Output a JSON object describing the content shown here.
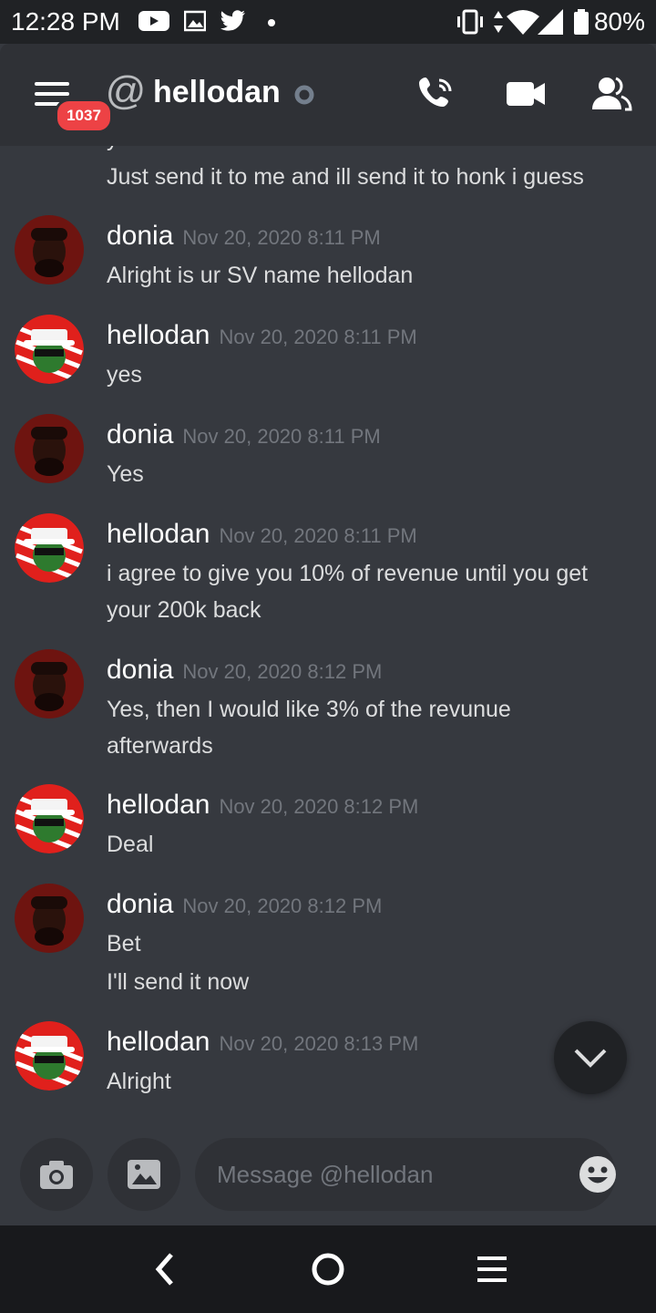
{
  "status_bar": {
    "time": "12:28 PM",
    "battery": "80%",
    "icons": [
      "youtube-icon",
      "gallery-icon",
      "twitter-icon",
      "dot-icon",
      "vibrate-icon",
      "data-arrows-icon",
      "wifi-icon",
      "signal-icon",
      "battery-icon"
    ]
  },
  "header": {
    "menu_badge": "1037",
    "channel_name": "hellodan",
    "icons": [
      "menu-icon",
      "at-icon",
      "offline-status-icon",
      "call-icon",
      "video-icon",
      "members-icon"
    ]
  },
  "messages": [
    {
      "partial_line": "Just send it to me and ill send it to honk i guess"
    },
    {
      "author": "donia",
      "timestamp": "Nov 20, 2020 8:11 PM",
      "lines": [
        "Alright is ur SV name hellodan"
      ]
    },
    {
      "author": "hellodan",
      "timestamp": "Nov 20, 2020 8:11 PM",
      "lines": [
        "yes"
      ]
    },
    {
      "author": "donia",
      "timestamp": "Nov 20, 2020 8:11 PM",
      "lines": [
        "Yes"
      ]
    },
    {
      "author": "hellodan",
      "timestamp": "Nov 20, 2020 8:11 PM",
      "lines": [
        "i agree to give you 10% of revenue until you get",
        "your 200k back"
      ]
    },
    {
      "author": "donia",
      "timestamp": "Nov 20, 2020 8:12 PM",
      "lines": [
        "Yes, then I would like 3% of the revunue",
        "afterwards"
      ]
    },
    {
      "author": "hellodan",
      "timestamp": "Nov 20, 2020 8:12 PM",
      "lines": [
        "Deal"
      ]
    },
    {
      "author": "donia",
      "timestamp": "Nov 20, 2020 8:12 PM",
      "lines": [
        "Bet",
        "I'll send it now"
      ]
    },
    {
      "author": "hellodan",
      "timestamp": "Nov 20, 2020 8:13 PM",
      "lines": [
        "Alright"
      ]
    }
  ],
  "composer": {
    "placeholder": "Message @hellodan",
    "value": ""
  },
  "colors": {
    "background": "#36393f",
    "header": "#2f3136",
    "badge": "#ed4245",
    "timestamp": "#72767d",
    "text": "#dcddde"
  }
}
